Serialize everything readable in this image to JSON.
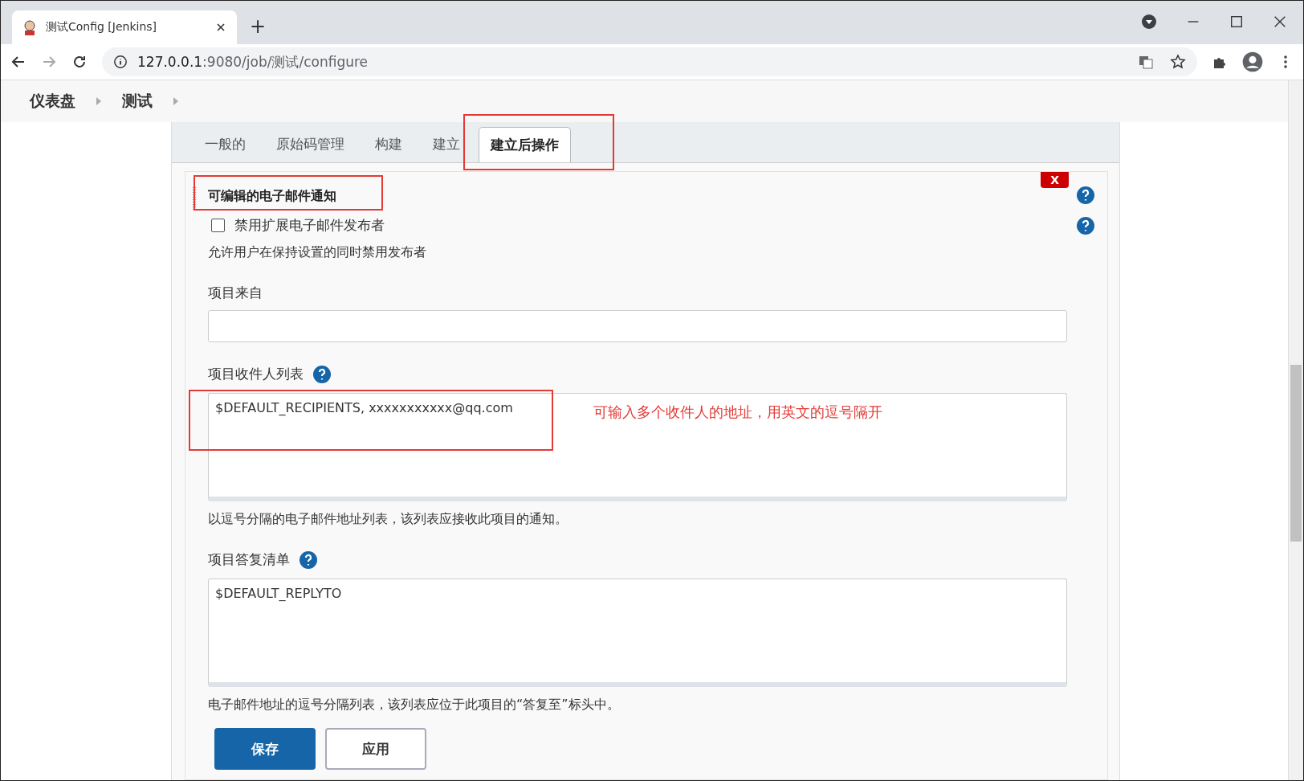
{
  "browser": {
    "tab_title": "测试Config [Jenkins]",
    "new_tab": "+",
    "address_host": "127.0.0.1",
    "address_path": ":9080/job/测试/configure"
  },
  "breadcrumb": [
    "仪表盘",
    "测试"
  ],
  "tabs": [
    {
      "label": "一般的",
      "selected": false
    },
    {
      "label": "原始码管理",
      "selected": false
    },
    {
      "label": "构建",
      "selected": false
    },
    {
      "label": "建立",
      "selected": false
    },
    {
      "label": "建立后操作",
      "selected": true
    }
  ],
  "section": {
    "title": "可编辑的电子邮件通知",
    "delete_button": "X",
    "checkbox": {
      "label": "禁用扩展电子邮件发布者",
      "checked": false
    },
    "checkbox_description": "允许用户在保持设置的同时禁用发布者",
    "fields": [
      {
        "kind": "input",
        "label": "项目来自",
        "help": false
      },
      {
        "kind": "textarea",
        "label": "项目收件人列表",
        "help": true,
        "value": "$DEFAULT_RECIPIENTS,  xxxxxxxxxxx@qq.com",
        "description": "以逗号分隔的电子邮件地址列表，该列表应接收此项目的通知。",
        "annotation": "可输入多个收件人的地址，用英文的逗号隔开"
      },
      {
        "kind": "textarea",
        "label": "项目答复清单",
        "help": true,
        "value": "$DEFAULT_REPLYTO",
        "description": "电子邮件地址的逗号分隔列表，该列表应位于此项目的“答复至”标头中。"
      }
    ]
  },
  "buttons": [
    {
      "label": "保存",
      "kind": "primary"
    },
    {
      "label": "应用",
      "kind": "secondary"
    }
  ]
}
